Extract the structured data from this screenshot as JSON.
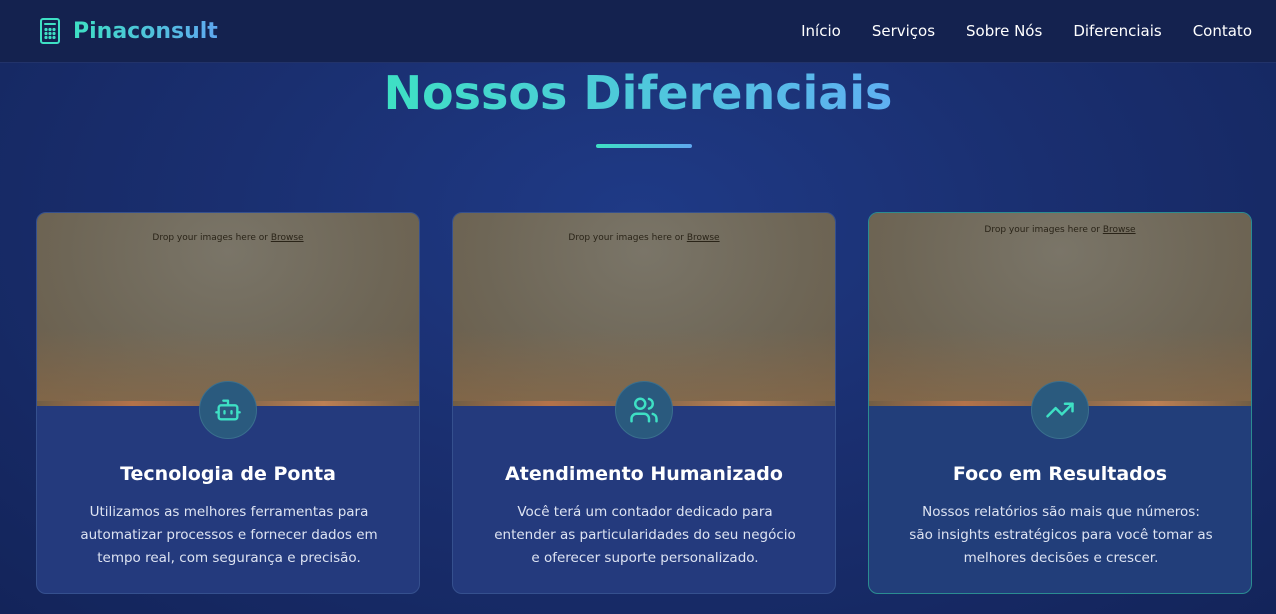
{
  "navbar": {
    "brand": "Pinaconsult",
    "brand_icon": "calculator-icon",
    "links": [
      "Início",
      "Serviços",
      "Sobre Nós",
      "Diferenciais",
      "Contato"
    ]
  },
  "section": {
    "title": "Nossos Diferenciais"
  },
  "cards": [
    {
      "image_placeholder": "Drop your images here or",
      "image_browse": "Browse",
      "icon": "robot-icon",
      "title": "Tecnologia de Ponta",
      "description": "Utilizamos as melhores ferramentas para automatizar processos e fornecer dados em tempo real, com segurança e precisão."
    },
    {
      "image_placeholder": "Drop your images here or",
      "image_browse": "Browse",
      "icon": "users-icon",
      "title": "Atendimento Humanizado",
      "description": "Você terá um contador dedicado para entender as particularidades do seu negócio e oferecer suporte personalizado."
    },
    {
      "image_placeholder": "Drop your images here or",
      "image_browse": "Browse",
      "icon": "trending-up-icon",
      "title": "Foco em Resultados",
      "description": "Nossos relatórios são mais que números: são insights estratégicos para você tomar as melhores decisões e crescer."
    }
  ],
  "colors": {
    "accent_start": "#3ee0c4",
    "accent_end": "#5fa8f0",
    "background": "#1a2f70",
    "card": "#243a7d"
  }
}
